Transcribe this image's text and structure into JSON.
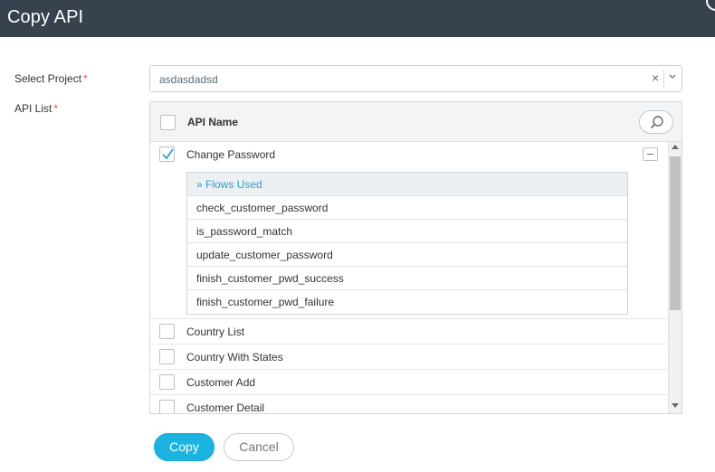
{
  "dialog": {
    "title": "Copy API"
  },
  "form": {
    "project_label": "Select Project",
    "api_list_label": "API List",
    "required_mark": "*",
    "project_value": "asdasdadsd",
    "clear_glyph": "×",
    "arrow_glyph": "⌄"
  },
  "api_table": {
    "header_label": "API Name",
    "items": [
      {
        "name": "Change Password",
        "checked": true,
        "expanded": true
      },
      {
        "name": "Country List",
        "checked": false
      },
      {
        "name": "Country With States",
        "checked": false
      },
      {
        "name": "Customer Add",
        "checked": false
      },
      {
        "name": "Customer Detail",
        "checked": false
      }
    ],
    "flows": {
      "header": "» Flows Used",
      "items": [
        "check_customer_password",
        "is_password_match",
        "update_customer_password",
        "finish_customer_pwd_success",
        "finish_customer_pwd_failure"
      ]
    }
  },
  "actions": {
    "copy_label": "Copy",
    "cancel_label": "Cancel"
  },
  "colors": {
    "header_bg": "#37424e",
    "accent": "#1bb3e0",
    "link": "#2a9fd6",
    "required": "#d9534f"
  },
  "icons": [
    "close-icon",
    "search-icon",
    "checkmark-icon",
    "collapse-icon",
    "chevron-down-icon"
  ]
}
